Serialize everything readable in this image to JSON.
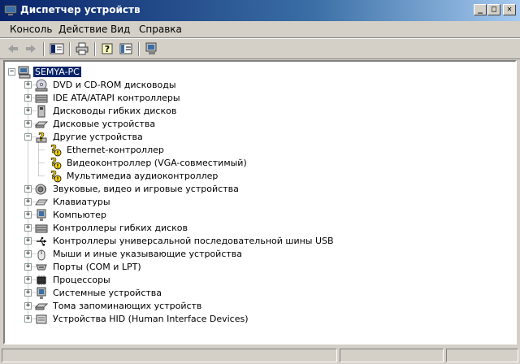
{
  "window": {
    "title": "Диспетчер устройств",
    "controls": {
      "minimize": "_",
      "maximize": "□",
      "close": "✕"
    }
  },
  "menu": [
    {
      "label": "Консоль"
    },
    {
      "label": "Действие"
    },
    {
      "label": "Вид"
    },
    {
      "label": "Справка"
    }
  ],
  "toolbar": [
    {
      "icon": "back-arrow-icon"
    },
    {
      "icon": "forward-arrow-icon"
    },
    {
      "icon": "show-hide-tree-icon"
    },
    {
      "icon": "print-icon"
    },
    {
      "icon": "help-icon"
    },
    {
      "icon": "properties-icon"
    },
    {
      "icon": "scan-hardware-icon"
    }
  ],
  "tree": {
    "root": {
      "label": "SEMYA-PC",
      "icon": "computer-icon",
      "expander": "−"
    },
    "items": [
      {
        "label": "DVD и CD-ROM дисководы",
        "icon": "cdrom-icon",
        "expander": "+"
      },
      {
        "label": "IDE ATA/ATAPI контроллеры",
        "icon": "ide-controller-icon",
        "expander": "+"
      },
      {
        "label": "Дисководы гибких дисков",
        "icon": "floppy-drive-icon",
        "expander": "+"
      },
      {
        "label": "Дисковые устройства",
        "icon": "disk-drive-icon",
        "expander": "+"
      },
      {
        "label": "Другие устройства",
        "icon": "unknown-device-icon",
        "expander": "−",
        "children": [
          {
            "label": "Ethernet-контроллер",
            "icon": "unknown-device-warning-icon"
          },
          {
            "label": "Видеоконтроллер (VGA-совместимый)",
            "icon": "unknown-device-warning-icon"
          },
          {
            "label": "Мультимедиа аудиоконтроллер",
            "icon": "unknown-device-warning-icon"
          }
        ]
      },
      {
        "label": "Звуковые, видео и игровые устройства",
        "icon": "sound-device-icon",
        "expander": "+"
      },
      {
        "label": "Клавиатуры",
        "icon": "keyboard-icon",
        "expander": "+"
      },
      {
        "label": "Компьютер",
        "icon": "monitor-icon",
        "expander": "+"
      },
      {
        "label": "Контроллеры гибких дисков",
        "icon": "floppy-controller-icon",
        "expander": "+"
      },
      {
        "label": "Контроллеры универсальной последовательной шины USB",
        "icon": "usb-icon",
        "expander": "+"
      },
      {
        "label": "Мыши и иные указывающие устройства",
        "icon": "mouse-icon",
        "expander": "+"
      },
      {
        "label": "Порты (COM и LPT)",
        "icon": "port-icon",
        "expander": "+"
      },
      {
        "label": "Процессоры",
        "icon": "processor-icon",
        "expander": "+"
      },
      {
        "label": "Системные устройства",
        "icon": "system-device-icon",
        "expander": "+"
      },
      {
        "label": "Тома запоминающих устройств",
        "icon": "storage-volume-icon",
        "expander": "+"
      },
      {
        "label": "Устройства HID (Human Interface Devices)",
        "icon": "hid-icon",
        "expander": "+"
      }
    ]
  },
  "colors": {
    "title_bar": "#0a246a",
    "selection": "#0a246a",
    "window_face": "#d4d0c8",
    "warning": "#ffd800"
  }
}
